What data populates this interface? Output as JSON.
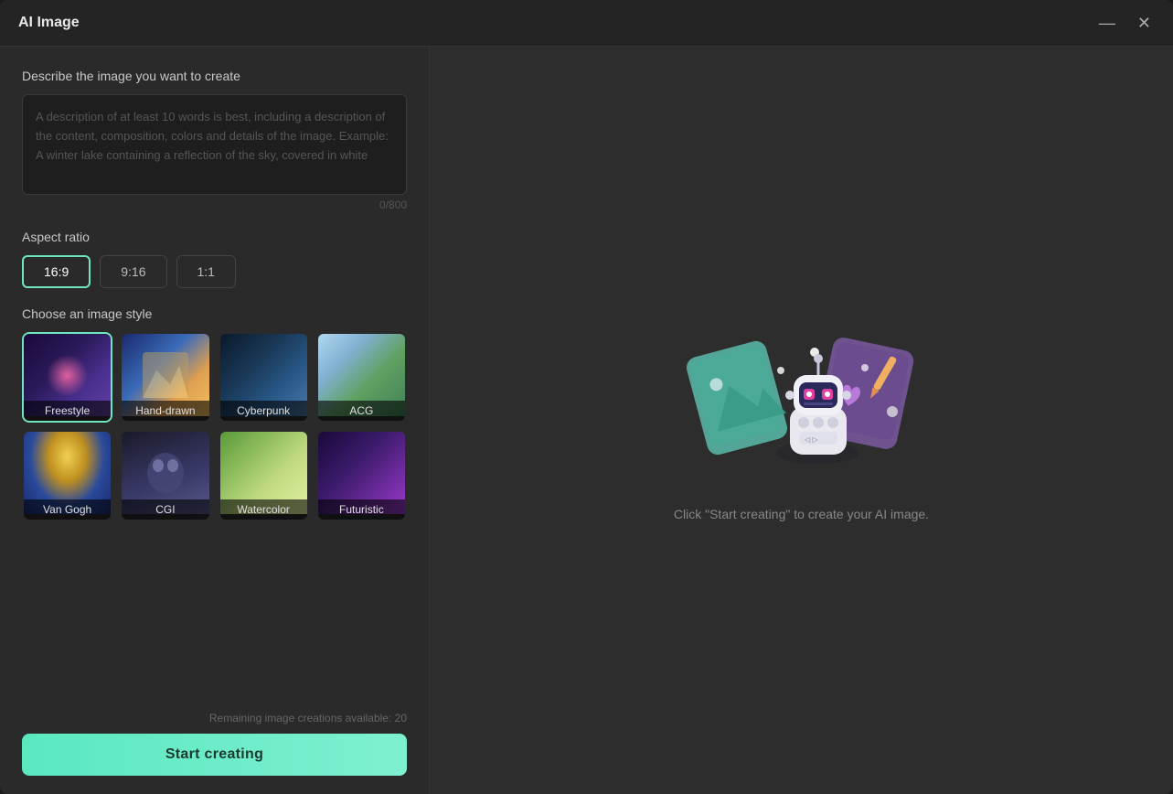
{
  "window": {
    "title": "AI Image",
    "minimize_label": "minimize",
    "close_label": "close"
  },
  "left": {
    "description_section_label": "Describe the image you want to create",
    "description_placeholder": "A description of at least 10 words is best, including a description of the content, composition, colors and details of the image. Example: A winter lake containing a reflection of the sky, covered in white",
    "char_count": "0/800",
    "aspect_ratio_label": "Aspect ratio",
    "aspect_options": [
      "16:9",
      "9:16",
      "1:1"
    ],
    "aspect_selected": "16:9",
    "style_section_label": "Choose an image style",
    "styles": [
      {
        "id": "freestyle",
        "label": "Freestyle",
        "selected": true
      },
      {
        "id": "handdrawn",
        "label": "Hand-drawn",
        "selected": false
      },
      {
        "id": "cyberpunk",
        "label": "Cyberpunk",
        "selected": false
      },
      {
        "id": "acg",
        "label": "ACG",
        "selected": false
      },
      {
        "id": "vangogh",
        "label": "Van Gogh",
        "selected": false
      },
      {
        "id": "cgi",
        "label": "CGI",
        "selected": false
      },
      {
        "id": "watercolor",
        "label": "Watercolor",
        "selected": false
      },
      {
        "id": "futuristic",
        "label": "Futuristic",
        "selected": false
      }
    ],
    "remaining_text": "Remaining image creations available: 20",
    "start_button_label": "Start creating"
  },
  "right": {
    "hint_text": "Click \"Start creating\" to create your AI image."
  }
}
